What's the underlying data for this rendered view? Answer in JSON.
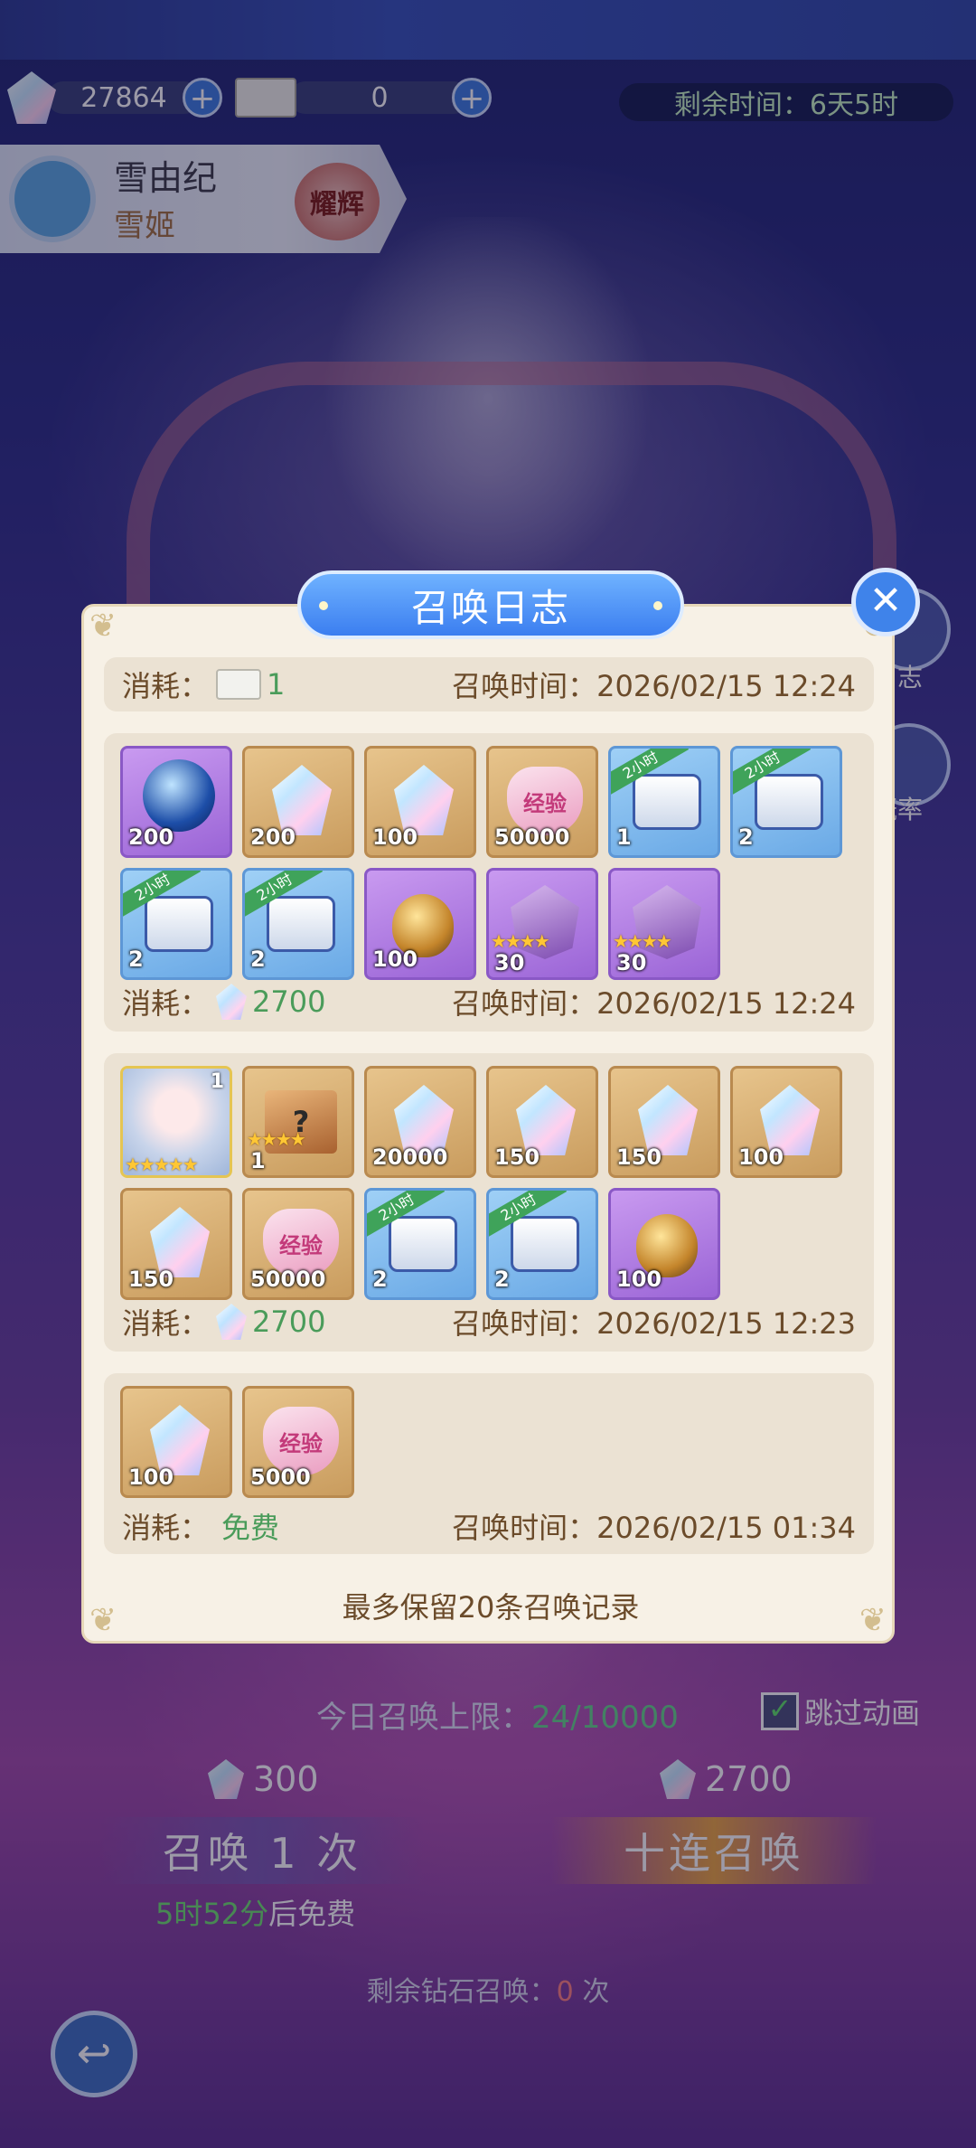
{
  "resources": {
    "gems": "27864",
    "tickets": "0",
    "plus": "+"
  },
  "event": {
    "remaining_label": "剩余时间：",
    "remaining_value": "6天5时"
  },
  "hero": {
    "name": "雪由纪",
    "subtitle": "雪姬",
    "badge": "耀辉"
  },
  "side_buttons": {
    "log_label": "日志",
    "rate_label": "概率"
  },
  "summon_panel": {
    "limit_label": "今日召唤上限：",
    "limit_value": "24/10000",
    "skip_label": "跳过动画",
    "skip_checked": "✓",
    "single_cost": "300",
    "ten_cost": "2700",
    "single_button": "召唤 1 次",
    "ten_button": "十连召唤",
    "free_time": "5时52分",
    "free_suffix": "后免费",
    "remaining_label": "剩余钻石召唤：",
    "remaining_value": "0",
    "remaining_unit": "次",
    "back_icon": "↩"
  },
  "dialog": {
    "title": "召唤日志",
    "close": "✕",
    "consume_label": "消耗：",
    "time_label": "召唤时间：",
    "records": [
      {
        "cost_icon": "ticket",
        "cost": "1",
        "time": "2026/02/15 12:24",
        "items": []
      },
      {
        "cost_icon": "gem",
        "cost": "2700",
        "time": "2026/02/15 12:24",
        "items": [
          {
            "type": "orb",
            "frame": "purple",
            "qty": "200"
          },
          {
            "type": "gem",
            "frame": "gold",
            "qty": "200"
          },
          {
            "type": "gem",
            "frame": "gold",
            "qty": "100"
          },
          {
            "type": "exp-heart",
            "frame": "gold",
            "qty": "50000",
            "label": "经验"
          },
          {
            "type": "chest",
            "frame": "blue",
            "qty": "1",
            "tag": "2小时"
          },
          {
            "type": "chest",
            "frame": "blue",
            "qty": "2",
            "tag": "2小时"
          },
          {
            "type": "chest",
            "frame": "blue",
            "qty": "2",
            "tag": "2小时"
          },
          {
            "type": "chest",
            "frame": "blue",
            "qty": "2",
            "tag": "2小时"
          },
          {
            "type": "egg",
            "frame": "purple",
            "qty": "100"
          },
          {
            "type": "shard",
            "frame": "purple",
            "qty": "30",
            "stars": "★★★★"
          },
          {
            "type": "shard",
            "frame": "purple",
            "qty": "30",
            "stars": "★★★★"
          }
        ]
      },
      {
        "cost_icon": "gem",
        "cost": "2700",
        "time": "2026/02/15 12:23",
        "items": [
          {
            "type": "hero-portrait",
            "frame": "hero",
            "qty": "",
            "corner": "1",
            "stars": "★★★★★"
          },
          {
            "type": "mystery-box",
            "frame": "gold",
            "qty": "1",
            "label": "?",
            "stars": "★★★★"
          },
          {
            "type": "gem",
            "frame": "gold",
            "qty": "20000"
          },
          {
            "type": "gem",
            "frame": "gold",
            "qty": "150"
          },
          {
            "type": "gem",
            "frame": "gold",
            "qty": "150"
          },
          {
            "type": "gem",
            "frame": "gold",
            "qty": "100"
          },
          {
            "type": "gem",
            "frame": "gold",
            "qty": "150"
          },
          {
            "type": "exp-heart",
            "frame": "gold",
            "qty": "50000",
            "label": "经验"
          },
          {
            "type": "chest",
            "frame": "blue",
            "qty": "2",
            "tag": "2小时"
          },
          {
            "type": "chest",
            "frame": "blue",
            "qty": "2",
            "tag": "2小时"
          },
          {
            "type": "egg",
            "frame": "purple",
            "qty": "100"
          }
        ]
      },
      {
        "cost_icon": "none",
        "cost": "免费",
        "time": "2026/02/15 01:34",
        "items": [
          {
            "type": "gem",
            "frame": "gold",
            "qty": "100"
          },
          {
            "type": "exp-heart",
            "frame": "gold",
            "qty": "5000",
            "label": "经验"
          }
        ]
      }
    ],
    "footnote": "最多保留20条召唤记录",
    "corner_ornament": "❦"
  },
  "colors": {
    "accent_blue": "#3b7ef0",
    "green_value": "#4a9c5a",
    "brown_text": "#6b4b2a",
    "dialog_bg": "#f7f1e6"
  }
}
